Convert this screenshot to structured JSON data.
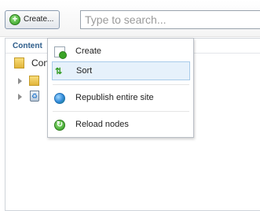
{
  "toolbar": {
    "create_button_label": "Create...",
    "search_placeholder": "Type to search..."
  },
  "panel": {
    "title": "Content",
    "tree": {
      "root_label": "Con"
    }
  },
  "context_menu": {
    "items": [
      {
        "label": "Create",
        "icon": "create-doc-icon"
      },
      {
        "label": "Sort",
        "icon": "sort-arrows-icon",
        "highlighted": true
      },
      {
        "label": "Republish entire site",
        "icon": "globe-icon"
      },
      {
        "label": "Reload nodes",
        "icon": "reload-icon"
      }
    ]
  },
  "colors": {
    "accent_green": "#2f9a1e",
    "panel_title_blue": "#2c5c8a",
    "highlight_bg": "#e6f1fb",
    "highlight_border": "#a8cbe9"
  }
}
